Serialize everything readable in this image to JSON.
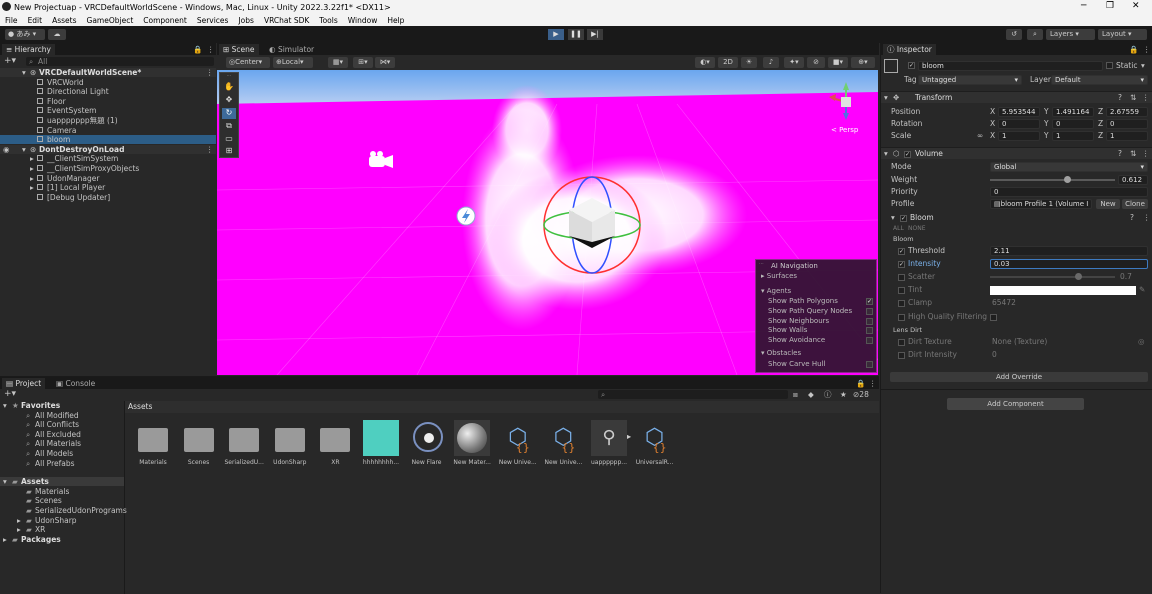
{
  "window": {
    "title": "New Projectuap - VRCDefaultWorldScene - Windows, Mac, Linux - Unity 2022.3.22f1* <DX11>"
  },
  "menu": [
    "File",
    "Edit",
    "Assets",
    "GameObject",
    "Component",
    "Services",
    "Jobs",
    "VRChat SDK",
    "Tools",
    "Window",
    "Help"
  ],
  "toolbar": {
    "account": "あみ",
    "layers": "Layers",
    "layout": "Layout"
  },
  "hierarchy": {
    "tab": "Hierarchy",
    "search_placeholder": "All",
    "items": [
      {
        "label": "VRCDefaultWorldScene*",
        "depth": 0,
        "scene": true
      },
      {
        "label": "VRCWorld",
        "depth": 1
      },
      {
        "label": "Directional Light",
        "depth": 1
      },
      {
        "label": "Floor",
        "depth": 1
      },
      {
        "label": "EventSystem",
        "depth": 1
      },
      {
        "label": "uappppppp無題 (1)",
        "depth": 1
      },
      {
        "label": "Camera",
        "depth": 1
      },
      {
        "label": "bloom",
        "depth": 1,
        "selected": true
      },
      {
        "label": "DontDestroyOnLoad",
        "depth": 0,
        "scene": true
      },
      {
        "label": "__ClientSimSystem",
        "depth": 1
      },
      {
        "label": "__ClientSimProxyObjects",
        "depth": 1
      },
      {
        "label": "UdonManager",
        "depth": 1
      },
      {
        "label": "[1] Local Player",
        "depth": 1
      },
      {
        "label": "[Debug Updater]",
        "depth": 1
      }
    ]
  },
  "scene": {
    "tabs": [
      "Scene",
      "Simulator"
    ],
    "pivot": "Center",
    "space": "Local",
    "view2d": "2D",
    "persp": "< Persp",
    "nav_overlay": {
      "title": "AI Navigation",
      "surfaces": "Surfaces",
      "agents": "Agents",
      "agent_items": [
        {
          "label": "Show Path Polygons",
          "checked": true
        },
        {
          "label": "Show Path Query Nodes",
          "checked": false
        },
        {
          "label": "Show Neighbours",
          "checked": false
        },
        {
          "label": "Show Walls",
          "checked": false
        },
        {
          "label": "Show Avoidance",
          "checked": false
        }
      ],
      "obstacles": "Obstacles",
      "obstacle_items": [
        {
          "label": "Show Carve Hull",
          "checked": false
        }
      ]
    }
  },
  "inspector": {
    "tab": "Inspector",
    "object_name": "bloom",
    "static_label": "Static",
    "tag_label": "Tag",
    "tag_value": "Untagged",
    "layer_label": "Layer",
    "layer_value": "Default",
    "transform": {
      "title": "Transform",
      "position_label": "Position",
      "position": [
        "5.953544",
        "1.491164",
        "2.67559"
      ],
      "rotation_label": "Rotation",
      "rotation": [
        "0",
        "0",
        "0"
      ],
      "scale_label": "Scale",
      "scale": [
        "1",
        "1",
        "1"
      ]
    },
    "volume": {
      "title": "Volume",
      "mode_label": "Mode",
      "mode": "Global",
      "weight_label": "Weight",
      "weight": "0.612",
      "weight_fraction": 0.612,
      "priority_label": "Priority",
      "priority": "0",
      "profile_label": "Profile",
      "profile": "bloom Profile 1 (Volume I",
      "new_label": "New",
      "clone_label": "Clone"
    },
    "bloom": {
      "title": "Bloom",
      "all": "ALL",
      "none": "NONE",
      "section_bloom": "Bloom",
      "threshold_label": "Threshold",
      "threshold": "2.11",
      "intensity_label": "Intensity",
      "intensity": "0.03",
      "scatter_label": "Scatter",
      "scatter": "0.7",
      "scatter_fraction": 0.7,
      "tint_label": "Tint",
      "clamp_label": "Clamp",
      "clamp": "65472",
      "hq_label": "High Quality Filtering",
      "section_lens": "Lens Dirt",
      "dirt_texture_label": "Dirt Texture",
      "dirt_texture": "None (Texture)",
      "dirt_intensity_label": "Dirt Intensity",
      "dirt_intensity": "0"
    },
    "add_override": "Add Override",
    "add_component": "Add Component"
  },
  "project": {
    "tabs": [
      "Project",
      "Console"
    ],
    "favorites_label": "Favorites",
    "favorites": [
      "All Modified",
      "All Conflicts",
      "All Excluded",
      "All Materials",
      "All Models",
      "All Prefabs"
    ],
    "assets_label": "Assets",
    "asset_folders": [
      "Materials",
      "Scenes",
      "SerializedUdonPrograms",
      "UdonSharp",
      "XR"
    ],
    "packages_label": "Packages",
    "breadcrumb": "Assets",
    "count": "28",
    "grid": [
      {
        "label": "Materials",
        "kind": "folder"
      },
      {
        "label": "Scenes",
        "kind": "folder"
      },
      {
        "label": "SerializedU...",
        "kind": "folder"
      },
      {
        "label": "UdonSharp",
        "kind": "folder"
      },
      {
        "label": "XR",
        "kind": "folder"
      },
      {
        "label": "hhhhhhhh...",
        "kind": "teal"
      },
      {
        "label": "New Flare",
        "kind": "flare"
      },
      {
        "label": "New Mater...",
        "kind": "sphere"
      },
      {
        "label": "New Unive...",
        "kind": "script"
      },
      {
        "label": "New Unive...",
        "kind": "script"
      },
      {
        "label": "uapppppp...",
        "kind": "model"
      },
      {
        "label": "UniversalR...",
        "kind": "script"
      }
    ]
  }
}
